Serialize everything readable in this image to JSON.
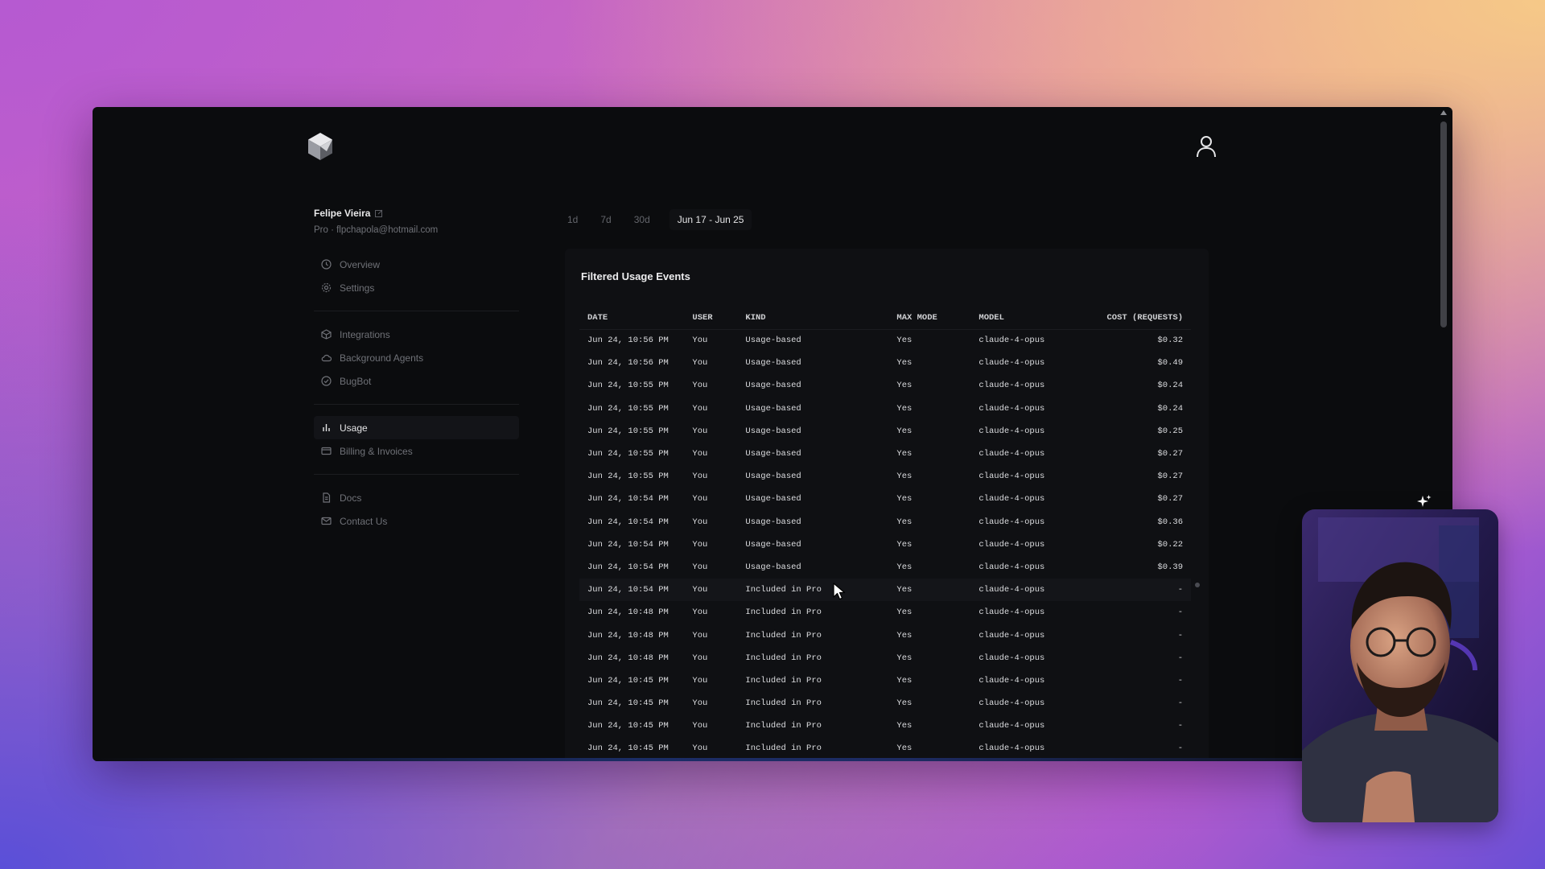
{
  "profile": {
    "name": "Felipe Vieira",
    "plan_email": "Pro · flpchapola@hotmail.com"
  },
  "sidebar": {
    "groups": [
      [
        {
          "label": "Overview",
          "icon": "clock-icon"
        },
        {
          "label": "Settings",
          "icon": "gear-icon"
        }
      ],
      [
        {
          "label": "Integrations",
          "icon": "cube-icon"
        },
        {
          "label": "Background Agents",
          "icon": "cloud-icon"
        },
        {
          "label": "BugBot",
          "icon": "check-circle-icon"
        }
      ],
      [
        {
          "label": "Usage",
          "icon": "bar-chart-icon",
          "active": true
        },
        {
          "label": "Billing & Invoices",
          "icon": "card-icon"
        }
      ],
      [
        {
          "label": "Docs",
          "icon": "document-icon"
        },
        {
          "label": "Contact Us",
          "icon": "mail-icon"
        }
      ]
    ]
  },
  "range": {
    "options": [
      "1d",
      "7d",
      "30d"
    ],
    "selected": "Jun 17 - Jun 25"
  },
  "usage": {
    "title": "Filtered Usage Events",
    "columns": [
      "DATE",
      "USER",
      "KIND",
      "MAX MODE",
      "MODEL",
      "COST (REQUESTS)"
    ],
    "rows": [
      [
        "Jun 24, 10:56 PM",
        "You",
        "Usage-based",
        "Yes",
        "claude-4-opus",
        "$0.32"
      ],
      [
        "Jun 24, 10:56 PM",
        "You",
        "Usage-based",
        "Yes",
        "claude-4-opus",
        "$0.49"
      ],
      [
        "Jun 24, 10:55 PM",
        "You",
        "Usage-based",
        "Yes",
        "claude-4-opus",
        "$0.24"
      ],
      [
        "Jun 24, 10:55 PM",
        "You",
        "Usage-based",
        "Yes",
        "claude-4-opus",
        "$0.24"
      ],
      [
        "Jun 24, 10:55 PM",
        "You",
        "Usage-based",
        "Yes",
        "claude-4-opus",
        "$0.25"
      ],
      [
        "Jun 24, 10:55 PM",
        "You",
        "Usage-based",
        "Yes",
        "claude-4-opus",
        "$0.27"
      ],
      [
        "Jun 24, 10:55 PM",
        "You",
        "Usage-based",
        "Yes",
        "claude-4-opus",
        "$0.27"
      ],
      [
        "Jun 24, 10:54 PM",
        "You",
        "Usage-based",
        "Yes",
        "claude-4-opus",
        "$0.27"
      ],
      [
        "Jun 24, 10:54 PM",
        "You",
        "Usage-based",
        "Yes",
        "claude-4-opus",
        "$0.36"
      ],
      [
        "Jun 24, 10:54 PM",
        "You",
        "Usage-based",
        "Yes",
        "claude-4-opus",
        "$0.22"
      ],
      [
        "Jun 24, 10:54 PM",
        "You",
        "Usage-based",
        "Yes",
        "claude-4-opus",
        "$0.39"
      ],
      [
        "Jun 24, 10:54 PM",
        "You",
        "Included in Pro",
        "Yes",
        "claude-4-opus",
        "-"
      ],
      [
        "Jun 24, 10:48 PM",
        "You",
        "Included in Pro",
        "Yes",
        "claude-4-opus",
        "-"
      ],
      [
        "Jun 24, 10:48 PM",
        "You",
        "Included in Pro",
        "Yes",
        "claude-4-opus",
        "-"
      ],
      [
        "Jun 24, 10:48 PM",
        "You",
        "Included in Pro",
        "Yes",
        "claude-4-opus",
        "-"
      ],
      [
        "Jun 24, 10:45 PM",
        "You",
        "Included in Pro",
        "Yes",
        "claude-4-opus",
        "-"
      ],
      [
        "Jun 24, 10:45 PM",
        "You",
        "Included in Pro",
        "Yes",
        "claude-4-opus",
        "-"
      ],
      [
        "Jun 24, 10:45 PM",
        "You",
        "Included in Pro",
        "Yes",
        "claude-4-opus",
        "-"
      ],
      [
        "Jun 24, 10:45 PM",
        "You",
        "Included in Pro",
        "Yes",
        "claude-4-opus",
        "-"
      ]
    ]
  }
}
